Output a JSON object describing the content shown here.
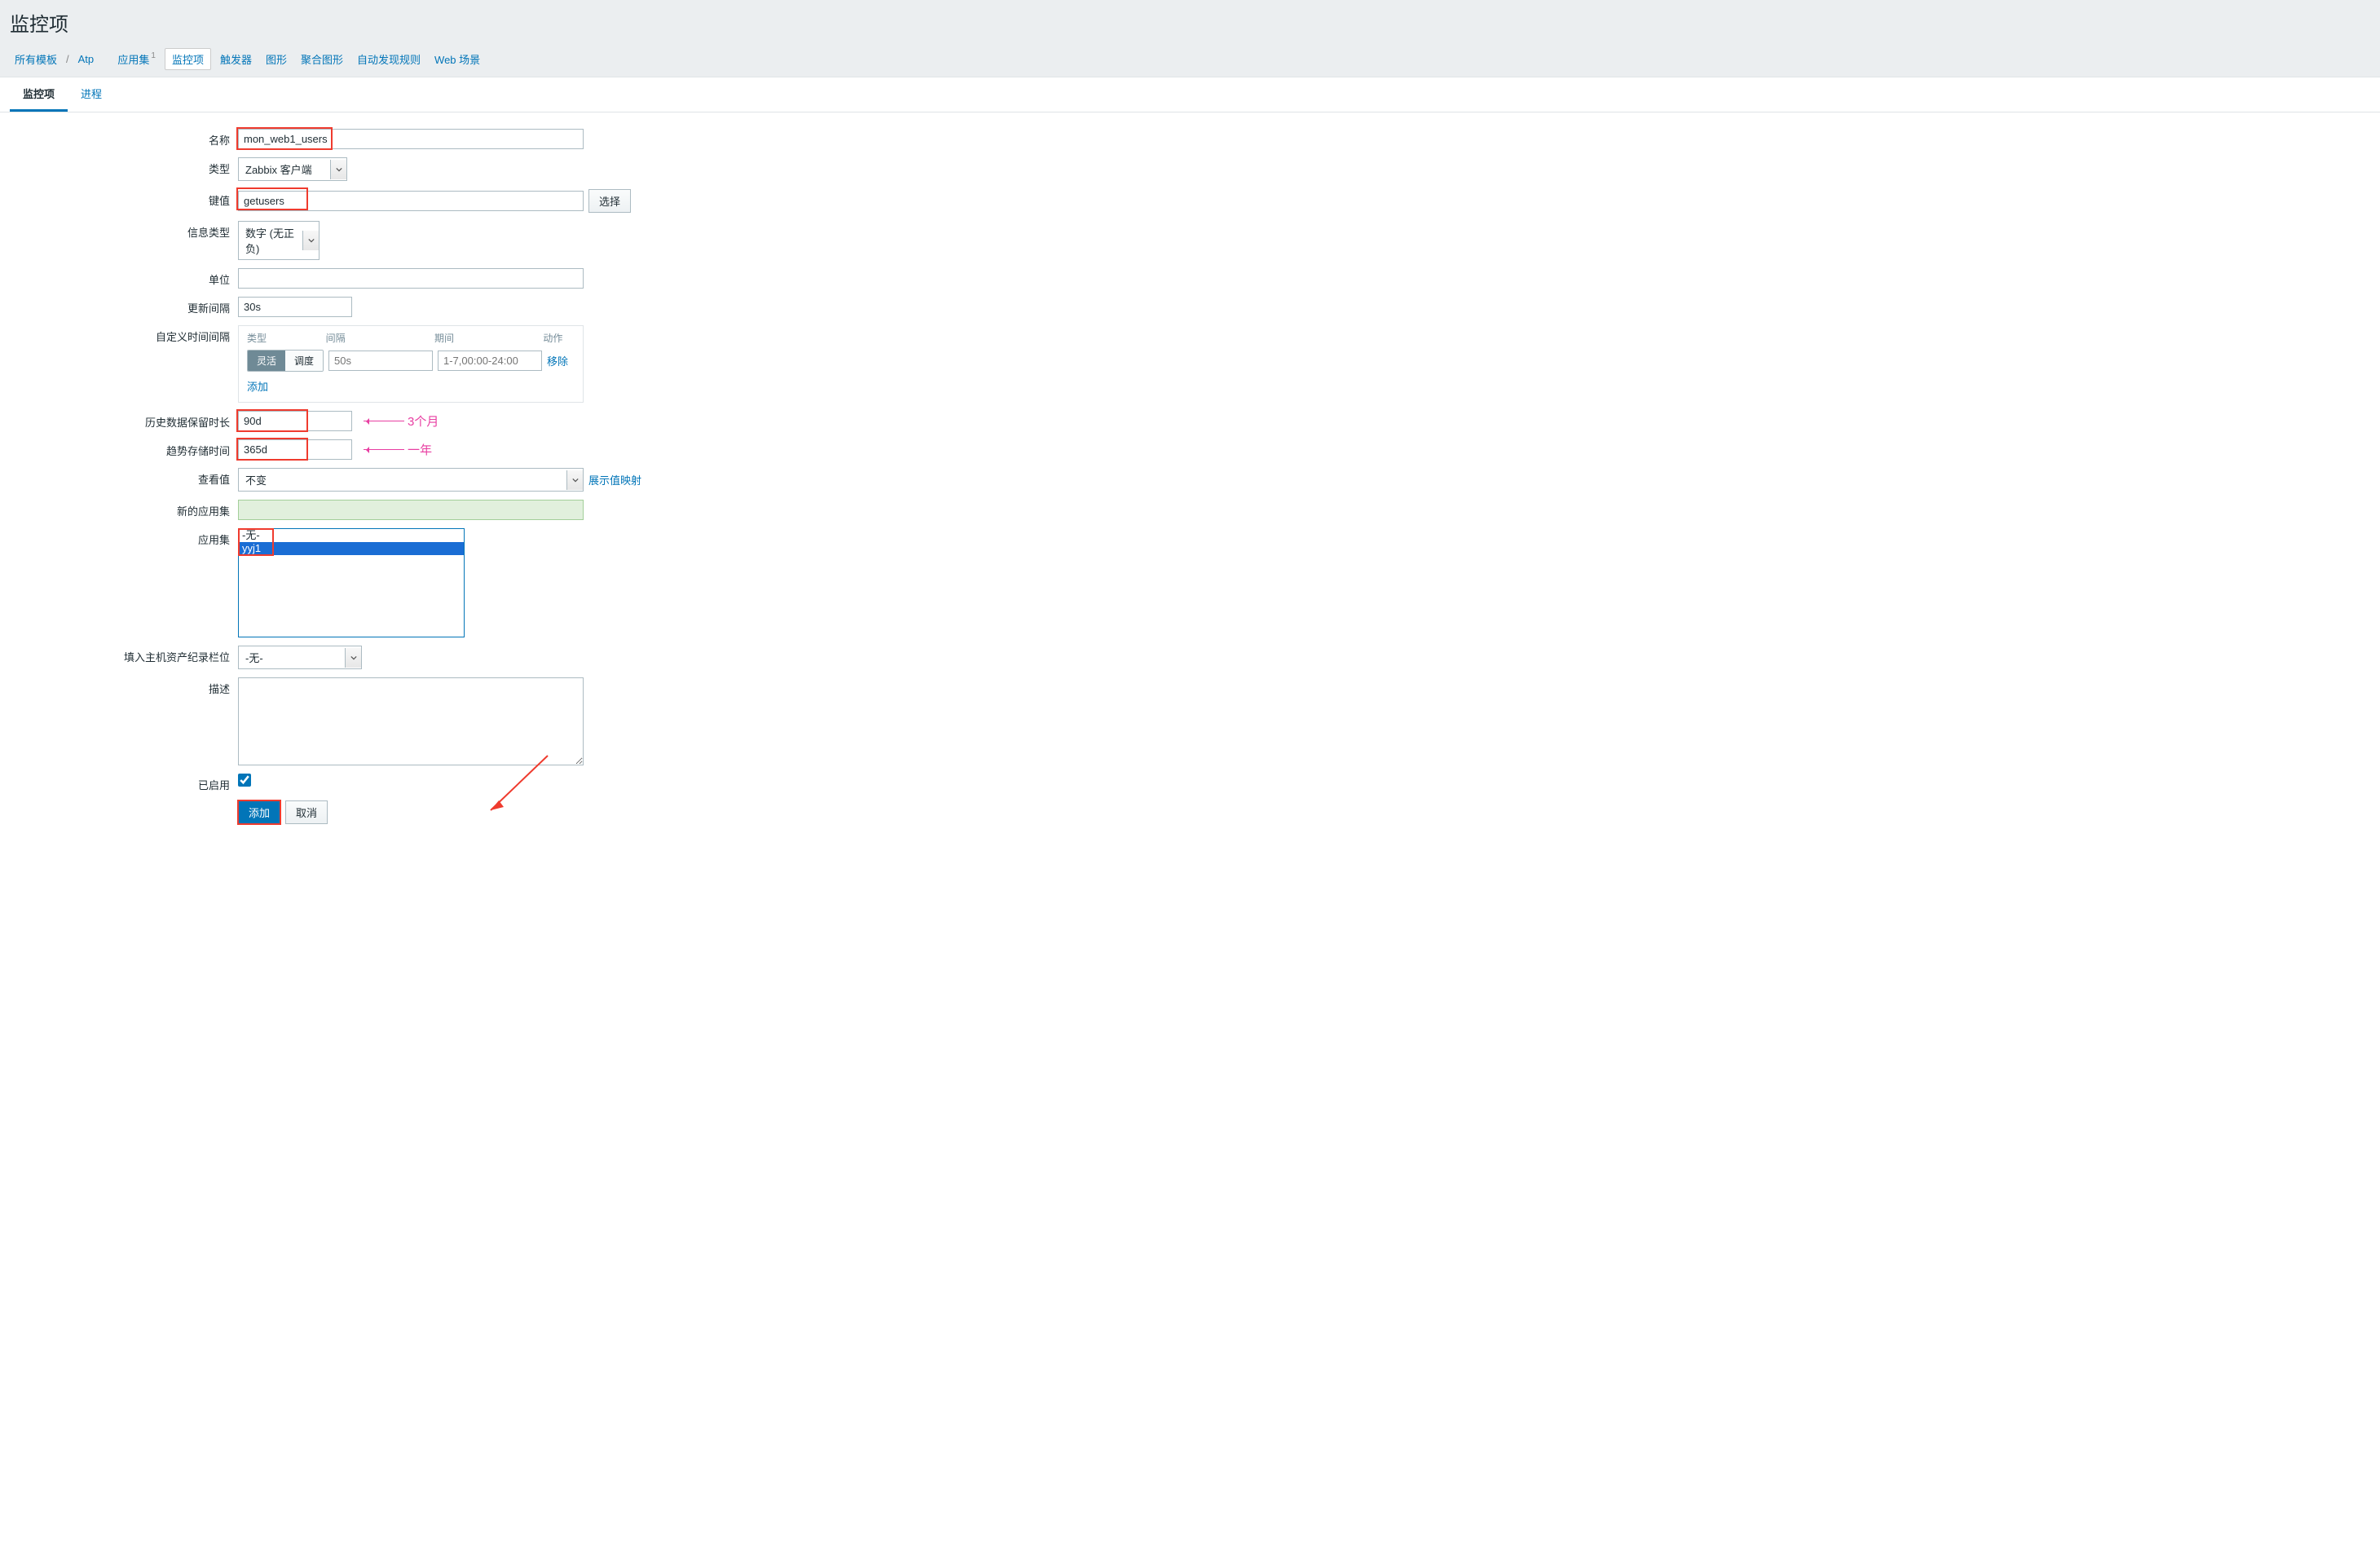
{
  "page_title": "监控项",
  "breadcrumb": {
    "all_templates": "所有模板",
    "template_name": "Atp",
    "applications": "应用集",
    "applications_count": "1",
    "items": "监控项",
    "triggers": "触发器",
    "graphs": "图形",
    "screens": "聚合图形",
    "discovery": "自动发现规则",
    "web": "Web 场景"
  },
  "tabs": {
    "item": "监控项",
    "process": "进程"
  },
  "labels": {
    "name": "名称",
    "type": "类型",
    "key": "键值",
    "info_type": "信息类型",
    "units": "单位",
    "update_interval": "更新间隔",
    "custom_intervals": "自定义时间间隔",
    "history": "历史数据保留时长",
    "trends": "趋势存储时间",
    "show_value": "查看值",
    "new_app": "新的应用集",
    "apps": "应用集",
    "inventory": "填入主机资产纪录栏位",
    "description": "描述",
    "enabled": "已启用"
  },
  "values": {
    "name": "mon_web1_users",
    "type": "Zabbix 客户端",
    "key": "getusers",
    "key_select_btn": "选择",
    "info_type": "数字 (无正负)",
    "units": "",
    "update_interval": "30s",
    "history": "90d",
    "trends": "365d",
    "show_value": "不变",
    "show_value_link": "展示值映射",
    "new_app": "",
    "app_opt_none": "-无-",
    "app_opt_1": "yyj1",
    "inventory": "-无-",
    "description": ""
  },
  "intervals": {
    "hdr_type": "类型",
    "hdr_interval": "间隔",
    "hdr_period": "期间",
    "hdr_action": "动作",
    "seg_flex": "灵活",
    "seg_sched": "调度",
    "interval_ph": "50s",
    "period_ph": "1-7,00:00-24:00",
    "remove": "移除",
    "add": "添加"
  },
  "annotations": {
    "history": "3个月",
    "trends": "一年"
  },
  "buttons": {
    "add": "添加",
    "cancel": "取消"
  }
}
